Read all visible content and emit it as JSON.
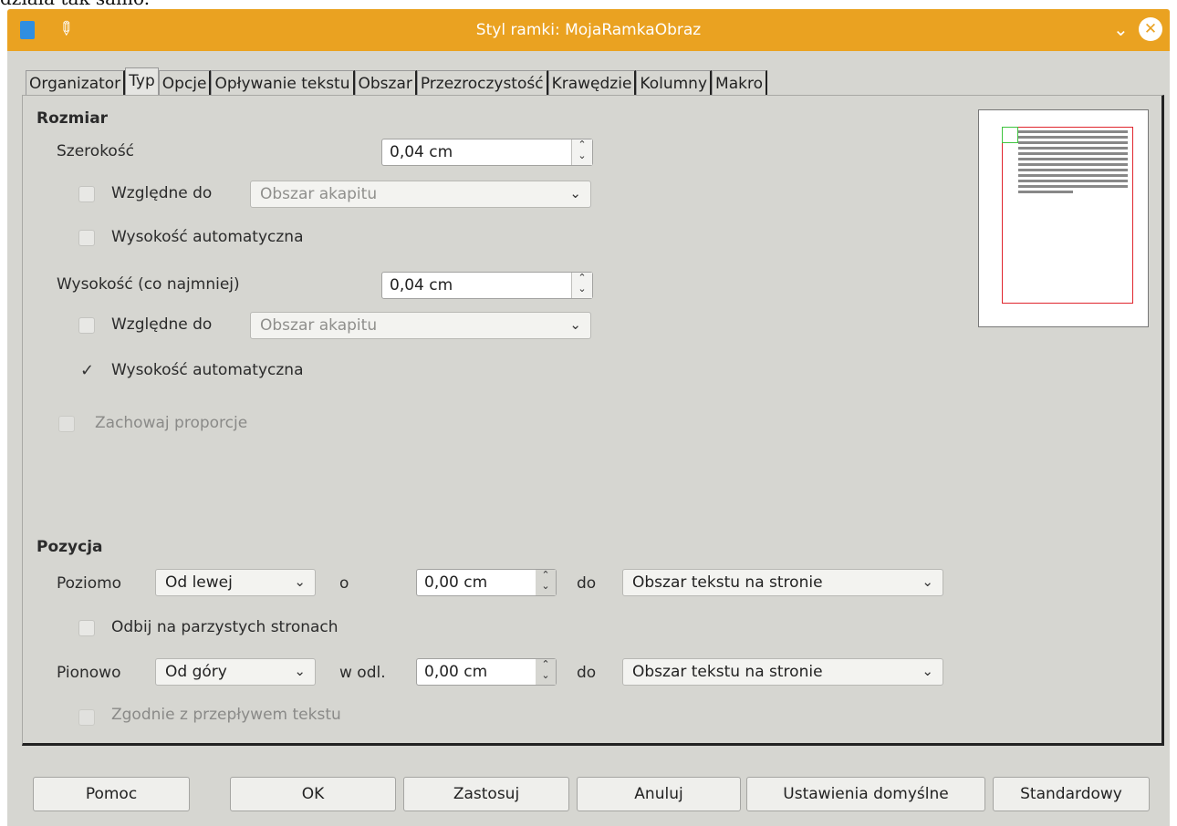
{
  "background_text": "działa tak samo.",
  "window": {
    "title": "Styl ramki: MojaRamkaObraz",
    "titlebar_color": "#eaa221"
  },
  "tabs": [
    "Organizator",
    "Typ",
    "Opcje",
    "Opływanie tekstu",
    "Obszar",
    "Przezroczystość",
    "Krawędzie",
    "Kolumny",
    "Makro"
  ],
  "size": {
    "heading": "Rozmiar",
    "width_label": "Szerokość",
    "width_value": "0,04 cm",
    "width_relative_label": "Względne do",
    "width_relative_value": "Obszar akapitu",
    "width_auto_label": "Wysokość automatyczna",
    "height_label": "Wysokość (co najmniej)",
    "height_value": "0,04 cm",
    "height_relative_label": "Względne do",
    "height_relative_value": "Obszar akapitu",
    "height_auto_label": "Wysokość automatyczna",
    "keep_ratio_label": "Zachowaj proporcje"
  },
  "position": {
    "heading": "Pozycja",
    "horizontal_label": "Poziomo",
    "horizontal_value": "Od lewej",
    "horizontal_by_label": "o",
    "horizontal_offset": "0,00 cm",
    "horizontal_to_label": "do",
    "horizontal_to_value": "Obszar tekstu na stronie",
    "mirror_label": "Odbij na parzystych stronach",
    "vertical_label": "Pionowo",
    "vertical_value": "Od góry",
    "vertical_by_label": "w odl.",
    "vertical_offset": "0,00 cm",
    "vertical_to_label": "do",
    "vertical_to_value": "Obszar tekstu na stronie",
    "follow_flow_label": "Zgodnie z przepływem tekstu"
  },
  "buttons": {
    "help": "Pomoc",
    "ok": "OK",
    "apply": "Zastosuj",
    "cancel": "Anuluj",
    "reset": "Ustawienia domyślne",
    "standard": "Standardowy"
  }
}
